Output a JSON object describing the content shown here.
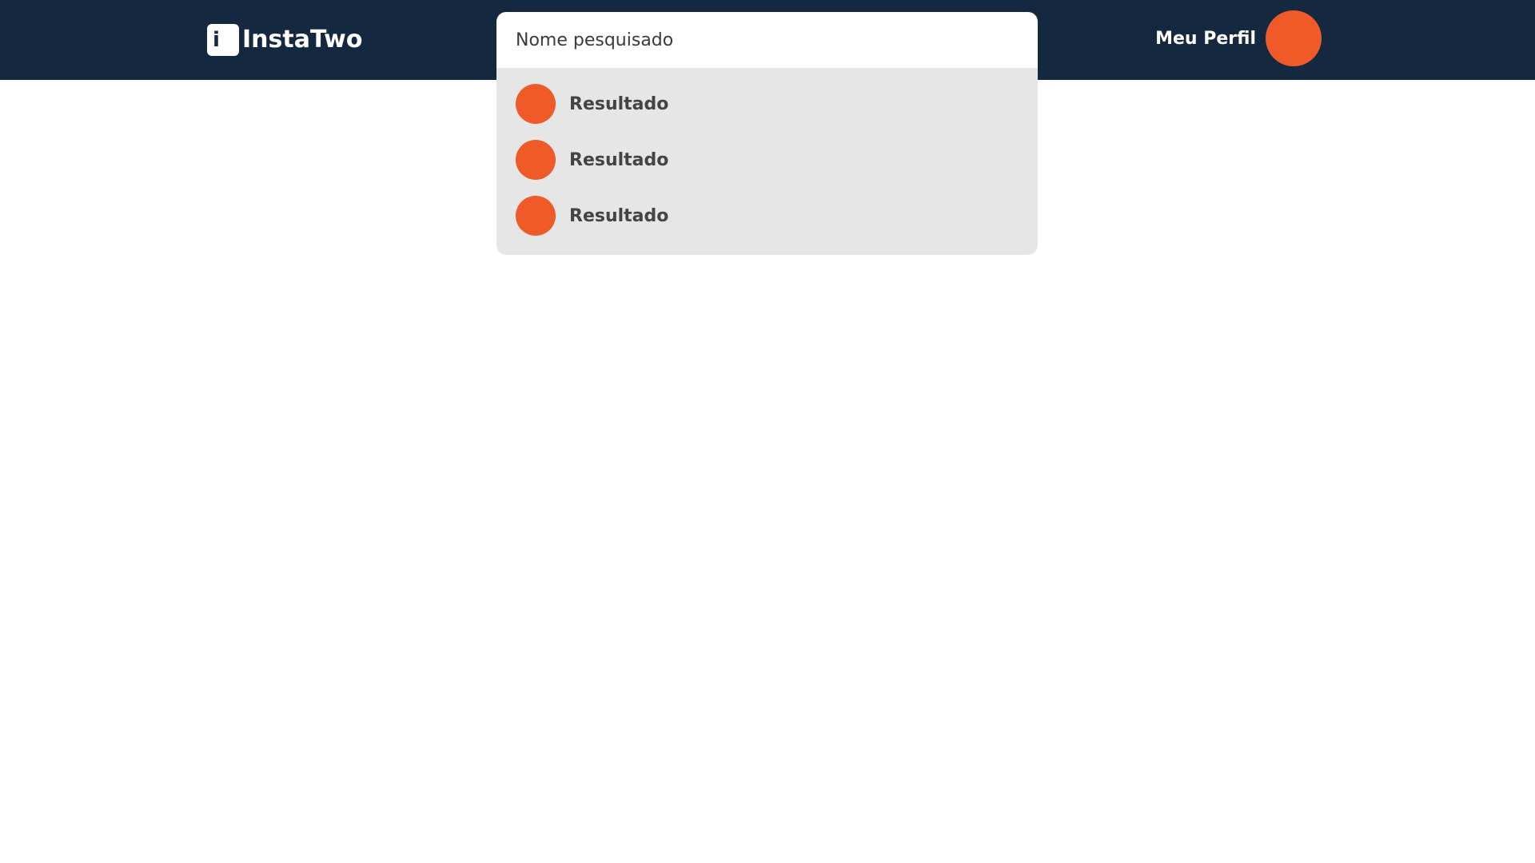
{
  "header": {
    "brand": {
      "icon": "i-logo-icon",
      "icon_glyph": "i",
      "name": "InstaTwo"
    },
    "search": {
      "value": "Nome pesquisado",
      "placeholder": ""
    },
    "profile": {
      "label": "Meu Perfil",
      "avatar_color": "#f05a28"
    }
  },
  "search_results": [
    {
      "name": "Resultado",
      "avatar_color": "#f05a28"
    },
    {
      "name": "Resultado",
      "avatar_color": "#f05a28"
    },
    {
      "name": "Resultado",
      "avatar_color": "#f05a28"
    }
  ],
  "colors": {
    "header_bg": "#142840",
    "accent": "#f05a28",
    "dropdown_bg": "#e6e6e6",
    "page_bg": "#ffffff"
  }
}
